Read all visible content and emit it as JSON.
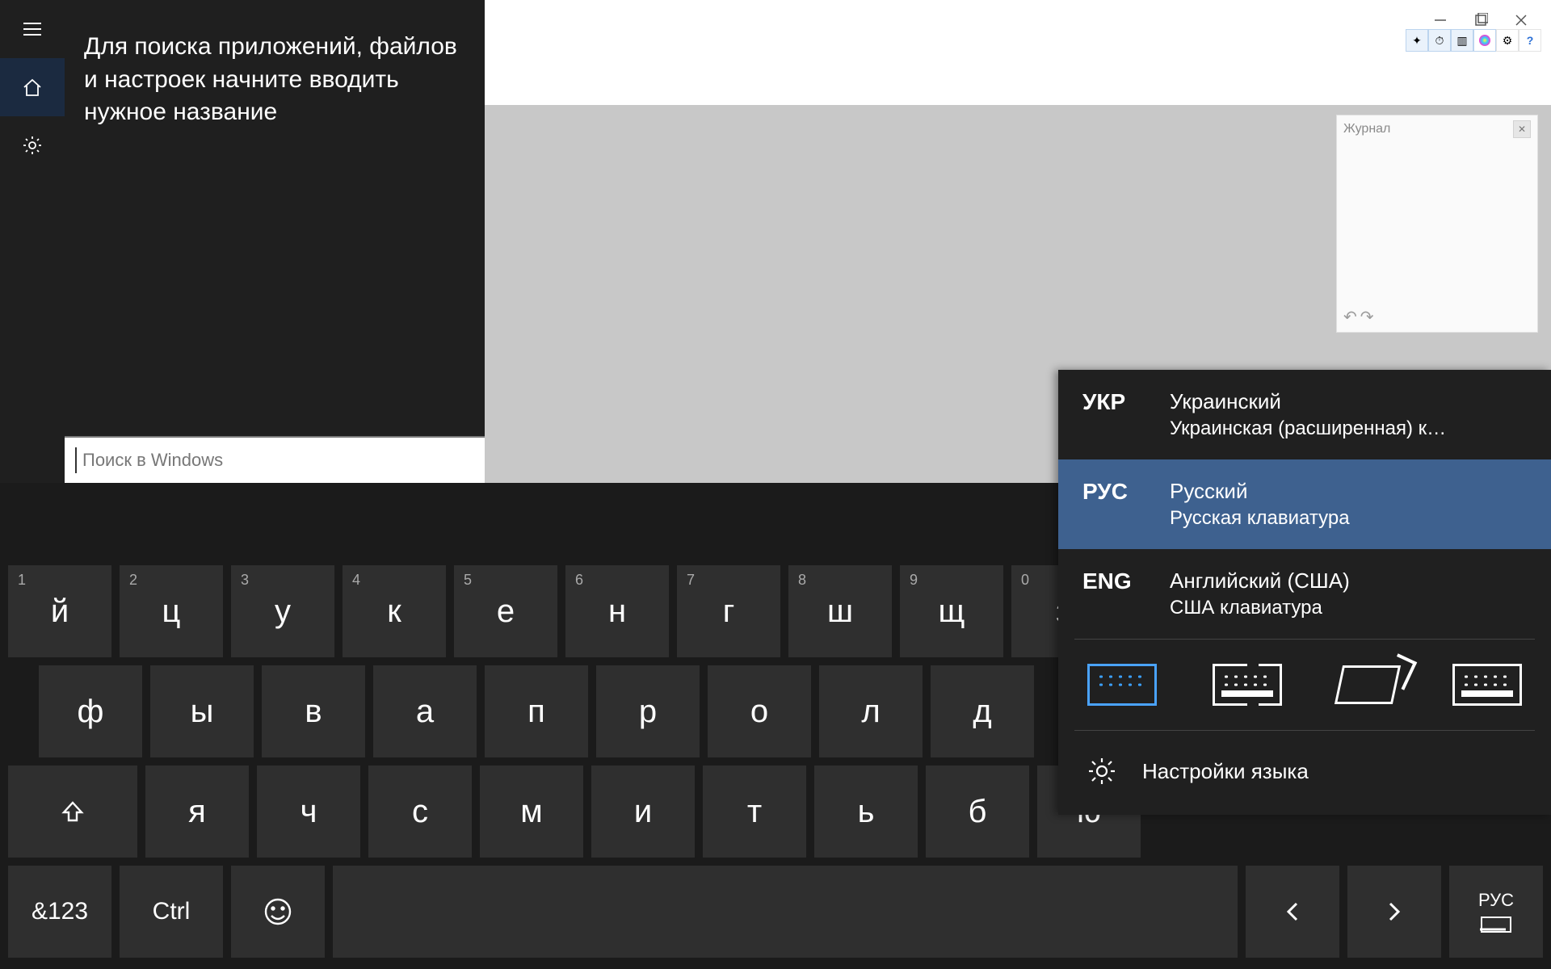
{
  "workspace": {
    "background": "#c8c8c8"
  },
  "journal": {
    "title": "Журнал"
  },
  "search": {
    "hint": "Для поиска приложений, файлов и настроек начните вводить нужное название",
    "placeholder": "Поиск в Windows"
  },
  "keyboard": {
    "row1": [
      {
        "k": "й",
        "n": "1"
      },
      {
        "k": "ц",
        "n": "2"
      },
      {
        "k": "у",
        "n": "3"
      },
      {
        "k": "к",
        "n": "4"
      },
      {
        "k": "е",
        "n": "5"
      },
      {
        "k": "н",
        "n": "6"
      },
      {
        "k": "г",
        "n": "7"
      },
      {
        "k": "ш",
        "n": "8"
      },
      {
        "k": "щ",
        "n": "9"
      },
      {
        "k": "з",
        "n": "0"
      }
    ],
    "row2": [
      "ф",
      "ы",
      "в",
      "а",
      "п",
      "р",
      "о",
      "л",
      "д"
    ],
    "row3": [
      "я",
      "ч",
      "с",
      "м",
      "и",
      "т",
      "ь",
      "б",
      "ю"
    ],
    "sym": "&123",
    "ctrl": "Ctrl",
    "lang_short": "РУС"
  },
  "lang_popup": {
    "items": [
      {
        "code": "УКР",
        "name": "Украинский",
        "layout": "Украинская (расширенная) к…",
        "selected": false
      },
      {
        "code": "РУС",
        "name": "Русский",
        "layout": "Русская клавиатура",
        "selected": true
      },
      {
        "code": "ENG",
        "name": "Английский (США)",
        "layout": "США клавиатура",
        "selected": false
      }
    ],
    "settings": "Настройки языка"
  }
}
